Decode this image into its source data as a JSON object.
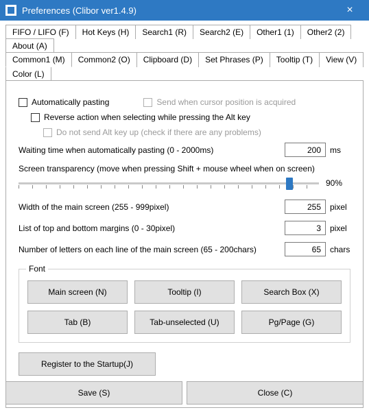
{
  "window": {
    "title": "Preferences  (Clibor ver1.4.9)"
  },
  "tabs_row1": [
    "FIFO / LIFO (F)",
    "Hot Keys (H)",
    "Search1 (R)",
    "Search2 (E)",
    "Other1 (1)",
    "Other2 (2)",
    "About (A)"
  ],
  "tabs_row2": [
    "Common1 (M)",
    "Common2 (O)",
    "Clipboard (D)",
    "Set Phrases (P)",
    "Tooltip (T)",
    "View (V)",
    "Color (L)"
  ],
  "active_tab": "Common1 (M)",
  "checks": {
    "auto_paste": "Automatically pasting",
    "send_cursor": "Send when cursor position is acquired",
    "reverse_alt": "Reverse action when selecting while pressing the Alt key",
    "no_alt_keyup": "Do not send Alt key up (check if there are any problems)"
  },
  "fields": {
    "wait": {
      "label": "Waiting time when automatically pasting (0 - 2000ms)",
      "value": "200",
      "unit": "ms"
    },
    "transparency": {
      "label": "Screen transparency (move when pressing Shift + mouse wheel when on screen)",
      "value": "90%"
    },
    "width": {
      "label": "Width of the main screen (255 - 999pixel)",
      "value": "255",
      "unit": "pixel"
    },
    "margins": {
      "label": "List of top and bottom margins (0 - 30pixel)",
      "value": "3",
      "unit": "pixel"
    },
    "chars": {
      "label": "Number of letters on each line of the main screen (65 - 200chars)",
      "value": "65",
      "unit": "chars"
    }
  },
  "font_group": {
    "legend": "Font",
    "buttons": [
      "Main screen (N)",
      "Tooltip (I)",
      "Search Box (X)",
      "Tab (B)",
      "Tab-unselected (U)",
      "Pg/Page (G)"
    ]
  },
  "startup_btn": "Register to the Startup(J)",
  "footer": {
    "save": "Save (S)",
    "close": "Close (C)"
  }
}
